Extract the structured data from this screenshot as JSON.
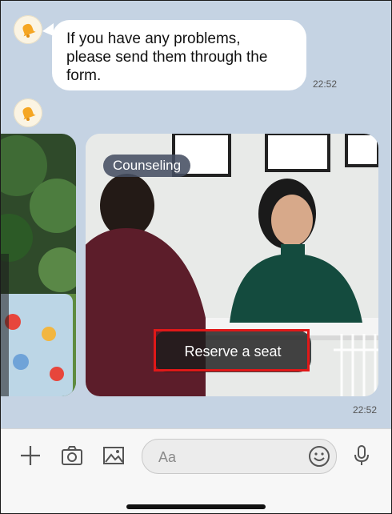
{
  "chat": {
    "message_text": "If you have any problems,\nplease send them through the\nform.",
    "message_time": "22:52",
    "card_time": "22:52",
    "card": {
      "tag": "Counseling",
      "cta_label": "Reserve a seat"
    }
  },
  "input_bar": {
    "placeholder": "Aa",
    "icons": [
      "plus-icon",
      "camera-icon",
      "image-icon",
      "emoji-icon",
      "microphone-icon"
    ]
  },
  "colors": {
    "chat_background": "#c5d3e3",
    "highlight": "#e01818",
    "bubble": "#ffffff"
  }
}
